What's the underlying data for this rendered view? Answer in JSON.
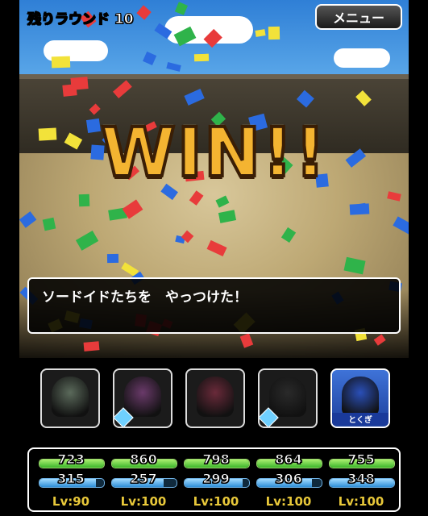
{
  "header": {
    "round_label": "残りラウンド 10",
    "menu_label": "メニュー"
  },
  "battle": {
    "result_text": "WIN!!",
    "message": "ソードイドたちを　やっつけた！"
  },
  "party": [
    {
      "name": "helmet-knight",
      "icon": "iron-helmet-icon",
      "badge": false,
      "active": false,
      "hp": "723",
      "mp": "315",
      "hp_fill": 1.0,
      "mp_fill": 0.88,
      "lv": "Lv:90"
    },
    {
      "name": "dark-witch",
      "icon": "witch-portrait-icon",
      "badge": true,
      "active": false,
      "hp": "860",
      "mp": "257",
      "hp_fill": 1.0,
      "mp_fill": 0.8,
      "lv": "Lv:100"
    },
    {
      "name": "voodoo-doll",
      "icon": "voodoo-doll-icon",
      "badge": false,
      "active": false,
      "hp": "798",
      "mp": "299",
      "hp_fill": 1.0,
      "mp_fill": 0.9,
      "lv": "Lv:100"
    },
    {
      "name": "dark-golem",
      "icon": "dark-golem-icon",
      "badge": true,
      "active": false,
      "hp": "864",
      "mp": "306",
      "hp_fill": 1.0,
      "mp_fill": 0.85,
      "lv": "Lv:100"
    },
    {
      "name": "eye-demon",
      "icon": "eye-demon-icon",
      "badge": false,
      "active": true,
      "tokugi_label": "とくぎ",
      "hp": "755",
      "mp": "348",
      "hp_fill": 1.0,
      "mp_fill": 1.0,
      "lv": "Lv:100"
    }
  ],
  "colors": {
    "win_gold": "#f4b431",
    "hp_green": "#3bb52b",
    "mp_blue": "#2e8ed8",
    "level_gold": "#e8c83a"
  }
}
